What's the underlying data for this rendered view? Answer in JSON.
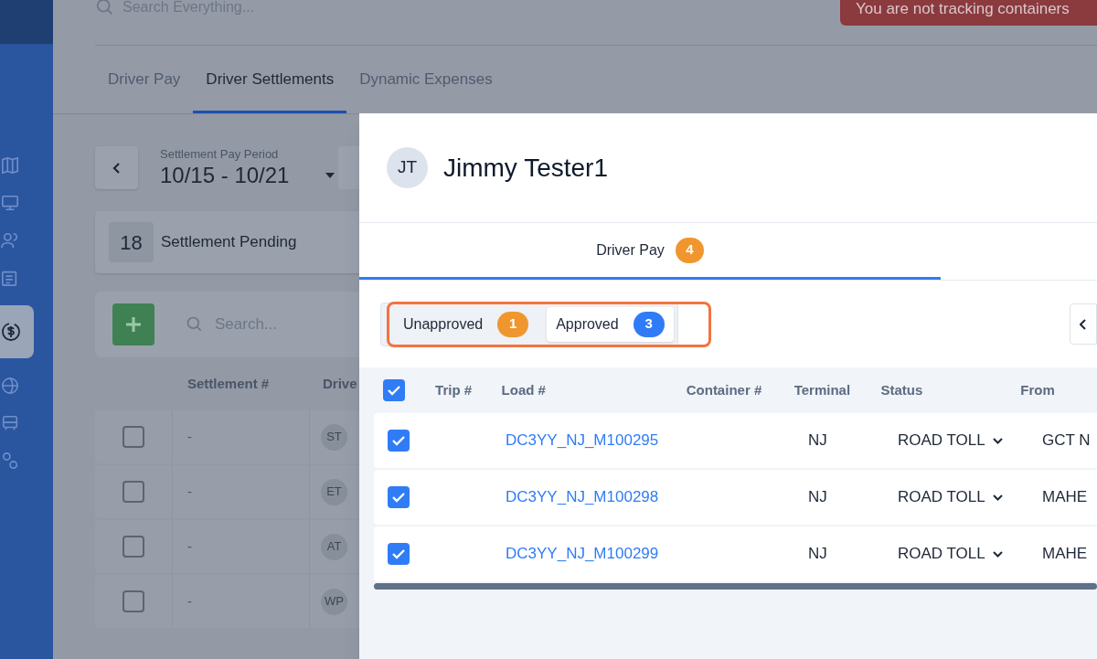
{
  "top_bar": {
    "search_placeholder": "Search Everything...",
    "alert": "You are not tracking containers"
  },
  "tabs": [
    {
      "label": "Driver Pay",
      "selected": false
    },
    {
      "label": "Driver Settlements",
      "selected": true
    },
    {
      "label": "Dynamic Expenses",
      "selected": false
    }
  ],
  "pay_period": {
    "label": "Settlement Pay Period",
    "value": "10/15 - 10/21"
  },
  "summary": {
    "count": "18",
    "label": "Settlement Pending"
  },
  "toolbar": {
    "search_placeholder": "Search..."
  },
  "settlements_table": {
    "columns": [
      "Settlement #",
      "Drive"
    ],
    "rows": [
      {
        "checked": false,
        "settlement": "-",
        "initials": "ST"
      },
      {
        "checked": false,
        "settlement": "-",
        "initials": "ET"
      },
      {
        "checked": false,
        "settlement": "-",
        "initials": "AT"
      },
      {
        "checked": false,
        "settlement": "-",
        "initials": "WP"
      }
    ]
  },
  "modal": {
    "initials": "JT",
    "name": "Jimmy Tester1",
    "tabs": [
      {
        "label": "Driver Pay",
        "badge": "4",
        "selected": true
      }
    ],
    "segments": [
      {
        "label": "Unapproved",
        "count": "1",
        "color": "#f0962e",
        "selected": false
      },
      {
        "label": "Approved",
        "count": "3",
        "color": "#2f7cf6",
        "selected": true
      }
    ],
    "table": {
      "header_checked": true,
      "columns": [
        "Trip #",
        "Load #",
        "Container #",
        "Terminal",
        "Status",
        "From"
      ],
      "rows": [
        {
          "checked": true,
          "load": "DC3YY_NJ_M100295",
          "terminal": "NJ",
          "status": "ROAD TOLL",
          "from": "GCT N"
        },
        {
          "checked": true,
          "load": "DC3YY_NJ_M100298",
          "terminal": "NJ",
          "status": "ROAD TOLL",
          "from": "MAHE"
        },
        {
          "checked": true,
          "load": "DC3YY_NJ_M100299",
          "terminal": "NJ",
          "status": "ROAD TOLL",
          "from": "MAHE"
        }
      ]
    }
  }
}
